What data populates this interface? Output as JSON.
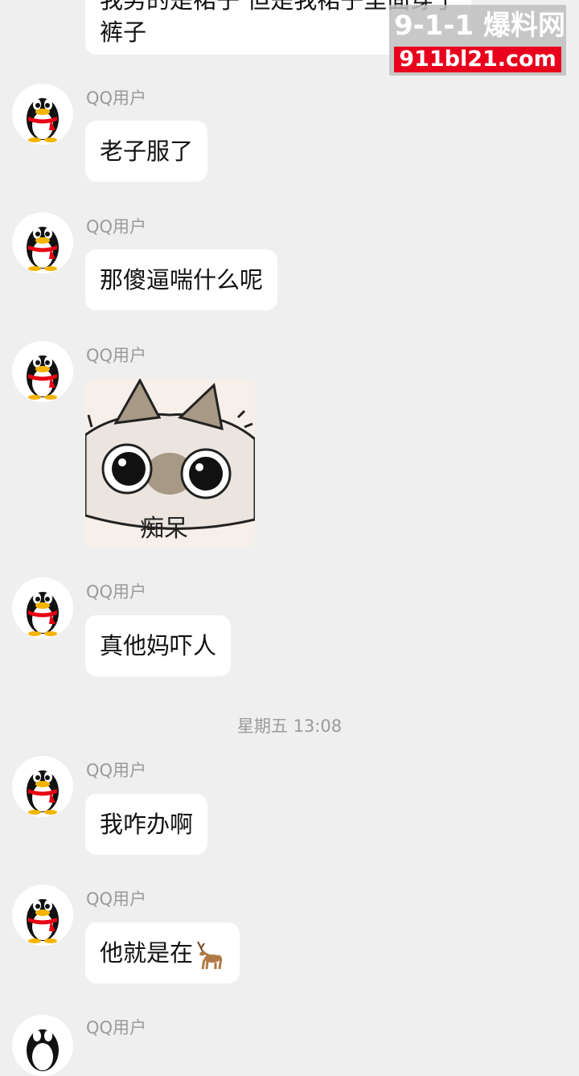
{
  "watermark": {
    "brand": "9-1-1 爆料网",
    "url": "911bl21.com"
  },
  "messages": [
    {
      "sender": "",
      "lines": [
        "我男的是裙子 但是我裙子里面穿了",
        "裤子"
      ]
    },
    {
      "sender": "QQ用户",
      "text": "老子服了"
    },
    {
      "sender": "QQ用户",
      "text": "那傻逼喘什么呢"
    },
    {
      "sender": "QQ用户",
      "sticker_caption": "痴呆"
    },
    {
      "sender": "QQ用户",
      "text": "真他妈吓人"
    },
    {
      "sender": "QQ用户",
      "text": "我咋办啊"
    },
    {
      "sender": "QQ用户",
      "text": "他就是在"
    },
    {
      "sender": "QQ用户"
    }
  ],
  "timestamp": "星期五 13:08",
  "icons": {
    "avatar": "qq-penguin-icon",
    "deer": "deer-emoji-icon"
  },
  "colors": {
    "background": "#efefef",
    "bubble": "#ffffff",
    "meta_text": "#9a9a9a",
    "watermark_red": "#e8001c"
  }
}
